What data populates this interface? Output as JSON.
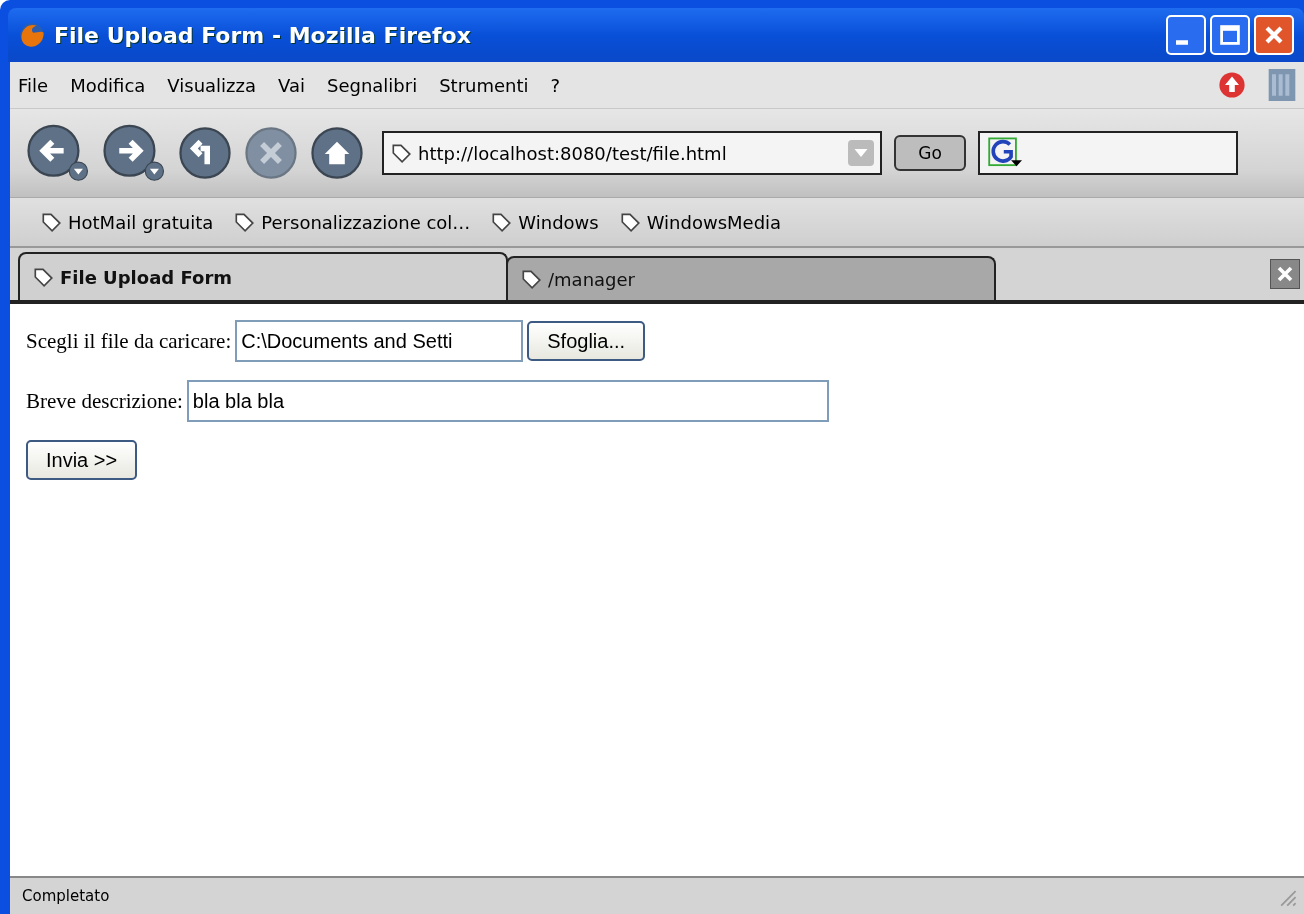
{
  "window": {
    "title": "File Upload Form - Mozilla Firefox"
  },
  "menu": [
    "File",
    "Modifica",
    "Visualizza",
    "Vai",
    "Segnalibri",
    "Strumenti",
    "?"
  ],
  "toolbar": {
    "address": "http://localhost:8080/test/file.html",
    "go_button": "Go"
  },
  "bookmarks": [
    "HotMail gratuita",
    "Personalizzazione col…",
    "Windows",
    "WindowsMedia"
  ],
  "tabs": [
    {
      "label": "File Upload Form",
      "selected": true
    },
    {
      "label": "/manager",
      "selected": false
    }
  ],
  "form": {
    "file_label": "Scegli il file da caricare:",
    "file_value": "C:\\Documents and Setti",
    "browse_button": "Sfoglia...",
    "description_label": "Breve descrizione:",
    "description_value": "bla bla bla",
    "submit_button": "Invia >>"
  },
  "status_bar": {
    "text": "Completato"
  }
}
